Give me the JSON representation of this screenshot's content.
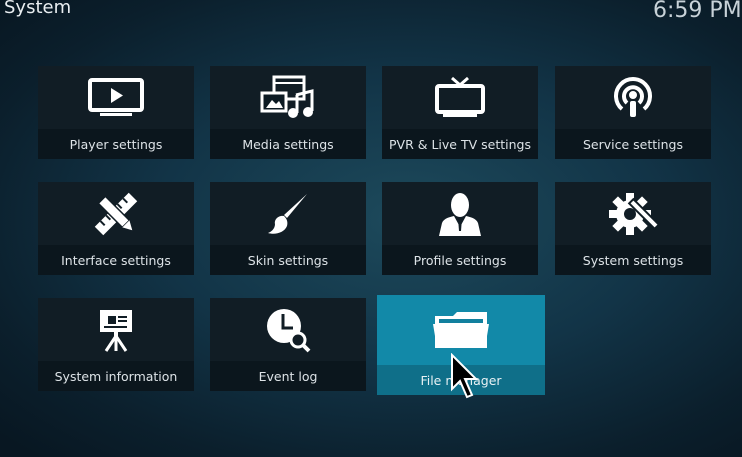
{
  "header": {
    "title": "System",
    "clock": "6:59 PM"
  },
  "tiles": [
    {
      "label": "Player settings",
      "icon": "monitor-play-icon"
    },
    {
      "label": "Media settings",
      "icon": "media-icon"
    },
    {
      "label": "PVR & Live TV settings",
      "icon": "tv-icon"
    },
    {
      "label": "Service settings",
      "icon": "podcast-icon"
    },
    {
      "label": "Interface settings",
      "icon": "pencil-ruler-icon"
    },
    {
      "label": "Skin settings",
      "icon": "paintbrush-icon"
    },
    {
      "label": "Profile settings",
      "icon": "user-icon"
    },
    {
      "label": "System settings",
      "icon": "gear-wrench-icon"
    },
    {
      "label": "System information",
      "icon": "presentation-icon"
    },
    {
      "label": "Event log",
      "icon": "clock-search-icon"
    },
    {
      "label": "File manager",
      "icon": "folder-icon"
    }
  ],
  "colors": {
    "accent": "#12809e",
    "tile_bg": "#111d25"
  }
}
